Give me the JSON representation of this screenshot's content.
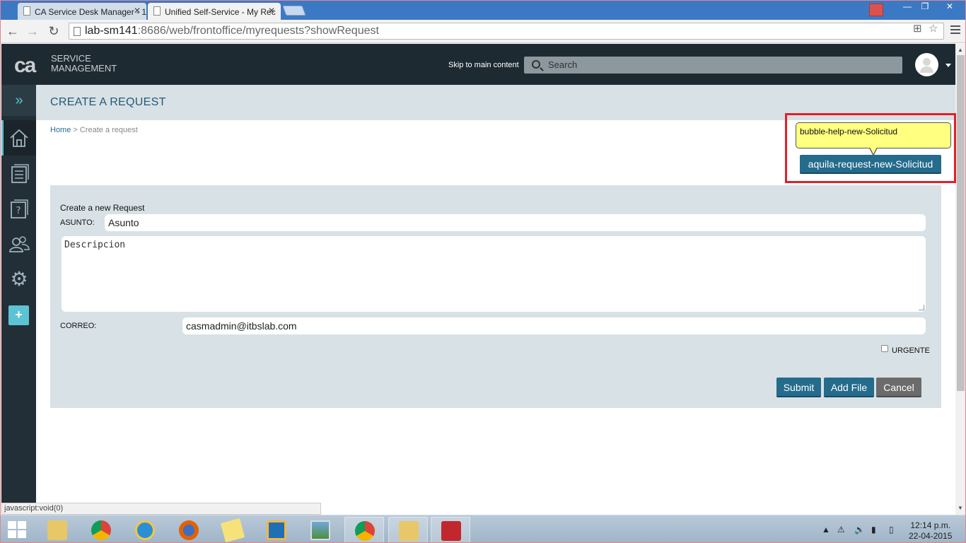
{
  "browser": {
    "tabs": [
      {
        "title": "CA Service Desk Manager - 1",
        "close": "✕"
      },
      {
        "title": "Unified Self-Service - My Rec",
        "close": "✕"
      }
    ],
    "url_host": "lab-sm141",
    "url_path": ":8686/web/frontoffice/myrequests?showRequest",
    "window_controls": [
      "—",
      "❐",
      "✕"
    ]
  },
  "header": {
    "logo_mark": "ca",
    "logo_line1": "SERVICE",
    "logo_line2": "MANAGEMENT",
    "skip_link": "Skip to main content",
    "search_placeholder": "Search"
  },
  "sidebar": {
    "items": [
      {
        "name": "expand",
        "icon": "chevron-double-right-icon"
      },
      {
        "name": "home",
        "icon": "home-icon"
      },
      {
        "name": "my-requests",
        "icon": "document-list-icon"
      },
      {
        "name": "knowledge",
        "icon": "question-document-icon"
      },
      {
        "name": "community",
        "icon": "users-icon"
      },
      {
        "name": "settings",
        "icon": "gear-icon"
      },
      {
        "name": "add",
        "icon": "plus-icon",
        "label": "+"
      }
    ],
    "accent_color": "#5cc3d4"
  },
  "page": {
    "title": "CREATE A REQUEST",
    "breadcrumb_home": "Home",
    "breadcrumb_sep": " > ",
    "breadcrumb_current": "Create a request"
  },
  "help": {
    "bubble_text": "bubble-help-new-Solicitud",
    "button_label": "aquila-request-new-Solicitud"
  },
  "form": {
    "heading": "Create a new Request",
    "asunto_label": "ASUNTO:",
    "asunto_value": "Asunto",
    "descripcion_value": "Descripcion",
    "correo_label": "CORREO:",
    "correo_value": "casmadmin@itbslab.com",
    "urgente_label": "URGENTE",
    "urgente_checked": false,
    "submit_label": "Submit",
    "addfile_label": "Add File",
    "cancel_label": "Cancel"
  },
  "status_bar": "javascript:void(0)",
  "taskbar": {
    "clock_time": "12:14 p.m.",
    "clock_date": "22-04-2015",
    "apps": [
      "file-explorer-icon",
      "chrome-icon",
      "internet-explorer-icon",
      "firefox-icon",
      "sticky-notes-icon",
      "outlook-icon",
      "picture-viewer-icon",
      "chrome-icon",
      "file-explorer-icon",
      "toolbox-icon"
    ]
  },
  "colors": {
    "header_bg": "#1e2a32",
    "primary_button": "#246b8c",
    "panel_bg": "#d8e1e5",
    "highlight_border": "#e0202a",
    "bubble_bg": "#ffff80"
  }
}
